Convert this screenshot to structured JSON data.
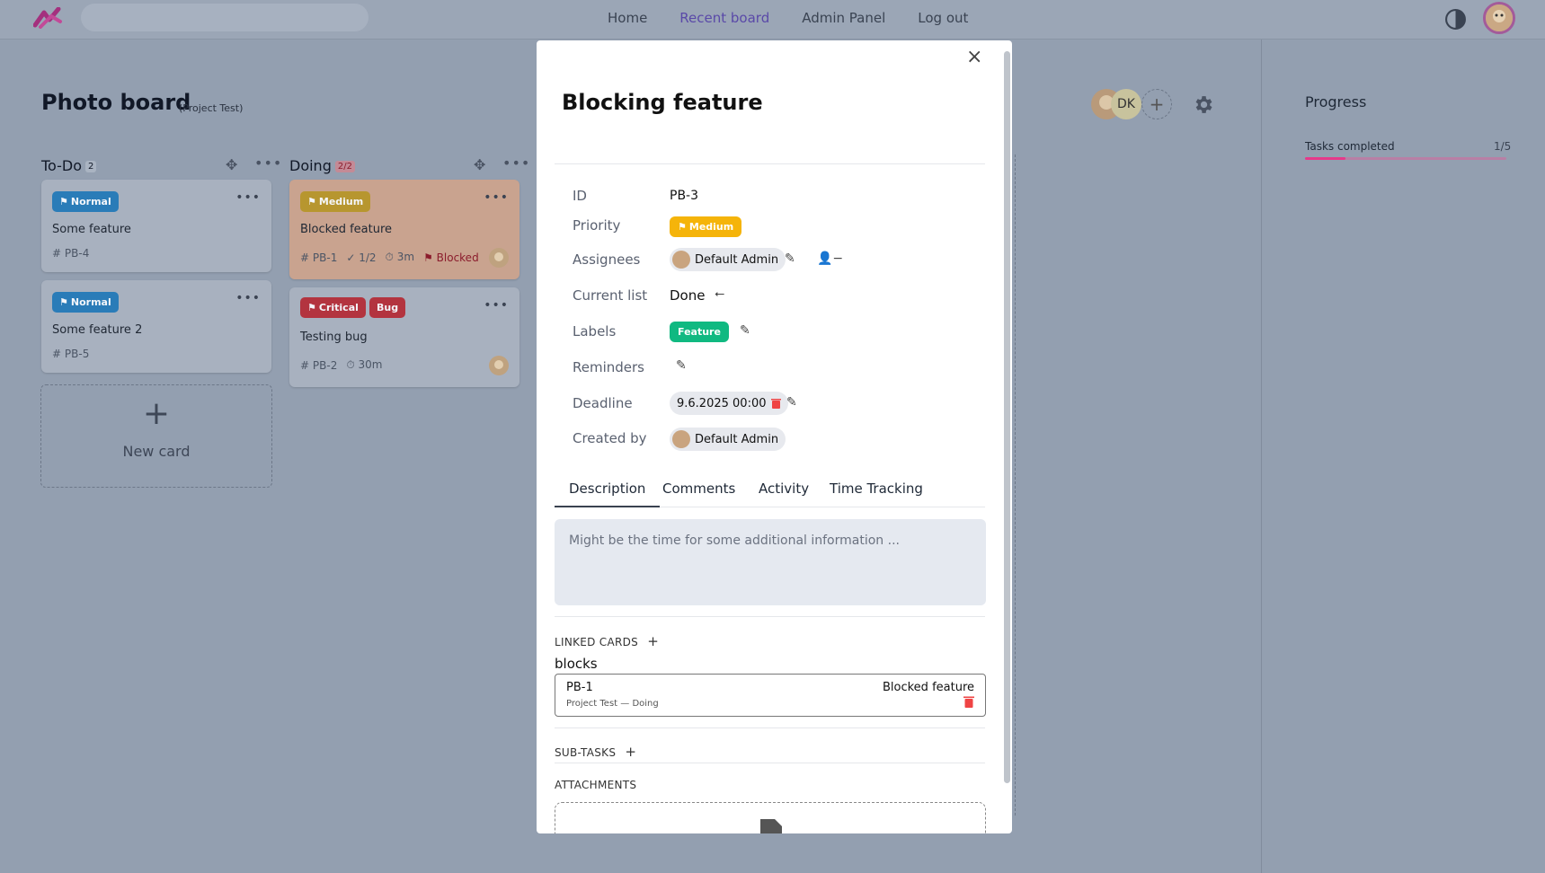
{
  "nav": {
    "links": [
      "Home",
      "Recent board",
      "Admin Panel",
      "Log out"
    ],
    "active_link": "Recent board",
    "accent": "#5a49a8"
  },
  "board": {
    "title": "Photo board",
    "subtitle": "(Project Test)",
    "member_initials": "DK",
    "add_member": "+"
  },
  "sidebar": {
    "title": "Progress",
    "tasks_label": "Tasks completed",
    "tasks_value": "1/5",
    "progress_fraction": 0.2
  },
  "columns": [
    {
      "name": "To-Do",
      "count": "2",
      "cards": [
        {
          "priority": "Normal",
          "title": "Some feature",
          "id": "PB-4"
        },
        {
          "priority": "Normal",
          "title": "Some feature 2",
          "id": "PB-5"
        }
      ]
    },
    {
      "name": "Doing",
      "count": "2/2",
      "cards": [
        {
          "priority": "Medium",
          "title": "Blocked feature",
          "id": "PB-1",
          "checklist": "1/2",
          "time": "3m",
          "status": "Blocked"
        },
        {
          "priority": "Critical",
          "label": "Bug",
          "title": "Testing bug",
          "id": "PB-2",
          "time": "30m"
        }
      ]
    }
  ],
  "new_card": {
    "plus": "+",
    "label": "New card"
  },
  "modal": {
    "title": "Blocking feature",
    "close": "×",
    "labels": {
      "id": "ID",
      "priority": "Priority",
      "assignees": "Assignees",
      "current_list": "Current list",
      "labels": "Labels",
      "reminders": "Reminders",
      "deadline": "Deadline",
      "created_by": "Created by"
    },
    "values": {
      "id": "PB-3",
      "priority": "Medium",
      "assignee": "Default Admin",
      "current_list": "Done",
      "label": "Feature",
      "deadline": "9.6.2025 00:00",
      "created_by": "Default Admin"
    },
    "tabs": [
      "Description",
      "Comments",
      "Activity",
      "Time Tracking"
    ],
    "active_tab": "Description",
    "description_placeholder": "Might be the time for some additional information ...",
    "linked_cards": {
      "heading": "LINKED CARDS",
      "relation": "blocks",
      "items": [
        {
          "id": "PB-1",
          "path": "Project Test — Doing",
          "title": "Blocked feature"
        }
      ]
    },
    "subtasks_heading": "SUB-TASKS",
    "attachments_heading": "ATTACHMENTS",
    "colors": {
      "medium": "#f5b40a",
      "feature": "#10b981",
      "danger": "#ef4444"
    }
  }
}
